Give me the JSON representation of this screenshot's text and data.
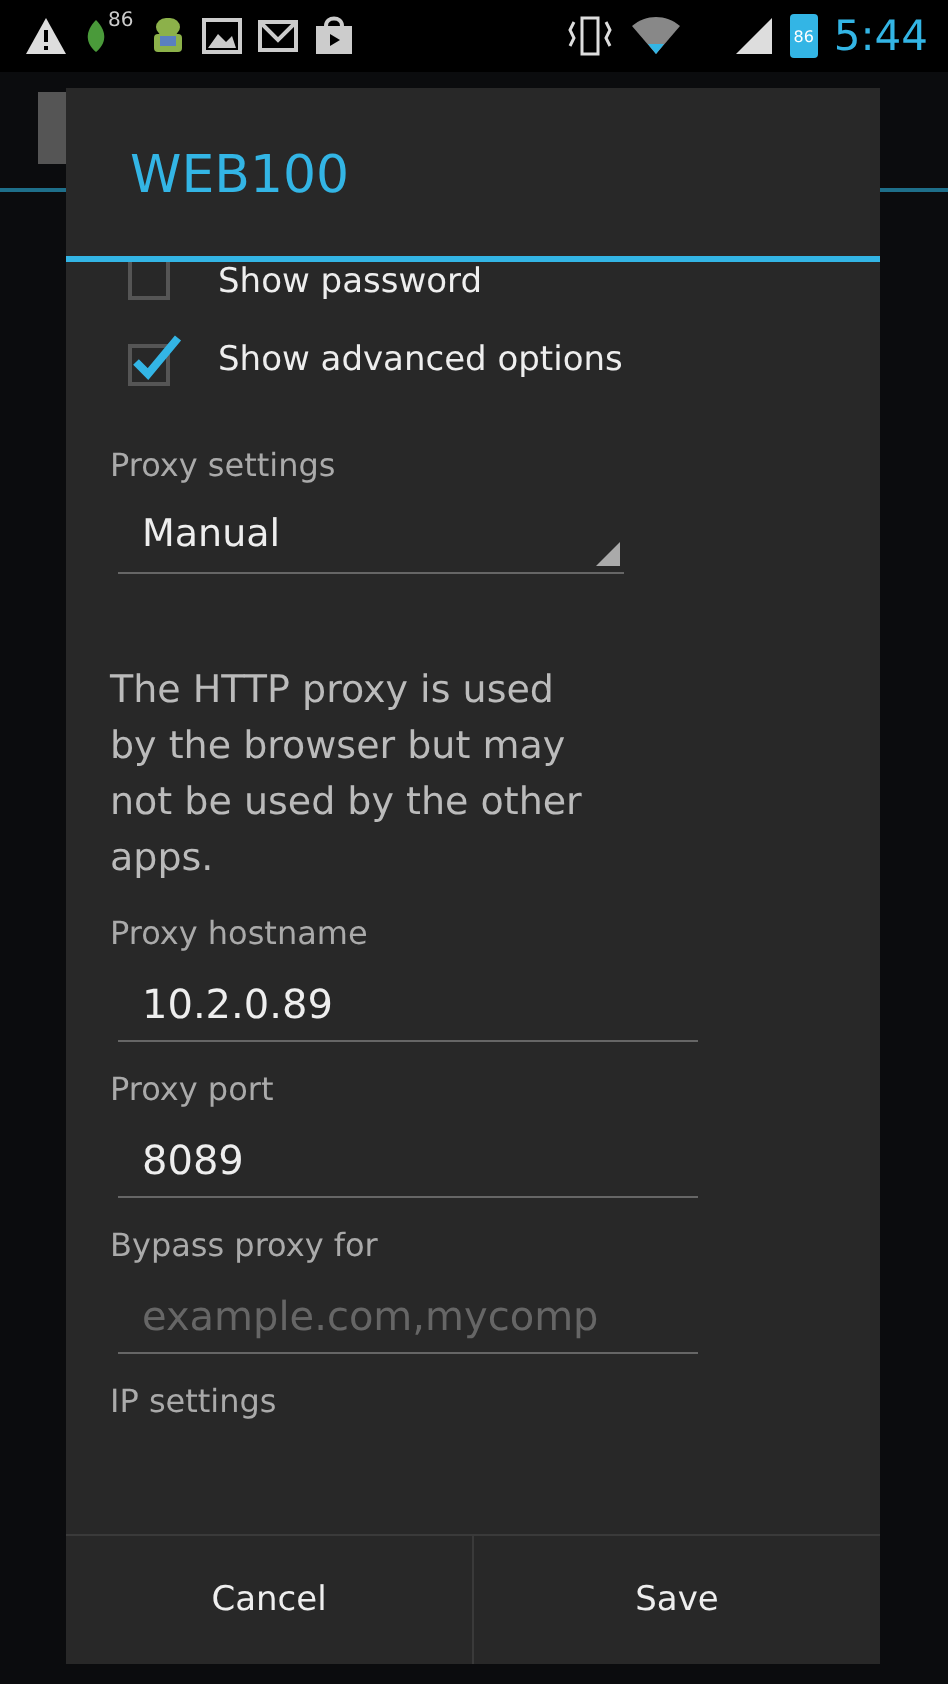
{
  "status_bar": {
    "leaf_badge": "86",
    "battery_level_text": "86",
    "time": "5:44"
  },
  "dialog": {
    "title": "WEB100",
    "checkboxes": [
      {
        "label": "Show password",
        "checked": false
      },
      {
        "label": "Show advanced options",
        "checked": true
      }
    ],
    "proxy_settings": {
      "label": "Proxy settings",
      "value": "Manual"
    },
    "note": "The HTTP proxy is used by the browser but may not be used by the other apps.",
    "fields": [
      {
        "label": "Proxy hostname",
        "value": "10.2.0.89"
      },
      {
        "label": "Proxy port",
        "value": "8089"
      },
      {
        "label": "Bypass proxy for",
        "placeholder": "example.com,mycomp"
      }
    ],
    "ip_settings_label": "IP settings",
    "buttons": [
      "Cancel",
      "Save"
    ]
  }
}
